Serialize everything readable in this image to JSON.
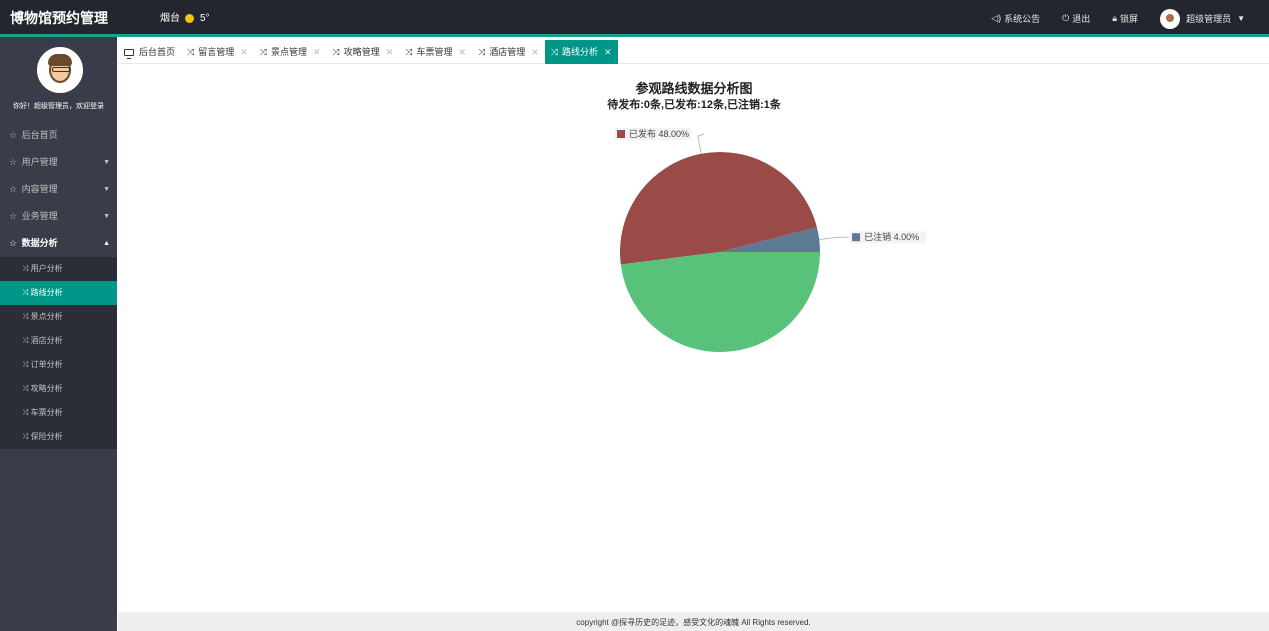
{
  "header": {
    "brand": "博物馆预约管理",
    "city": "烟台",
    "temperature": "5°",
    "notice": "系统公告",
    "logout": "退出",
    "lock": "锁屏",
    "user_name": "超级管理员"
  },
  "sidebar": {
    "welcome": "你好！超级管理员，欢迎登录",
    "menus": [
      {
        "label": "后台首页"
      },
      {
        "label": "用户管理"
      },
      {
        "label": "内容管理"
      },
      {
        "label": "业务管理"
      },
      {
        "label": "数据分析"
      }
    ],
    "sub_items": [
      {
        "label": "用户分析"
      },
      {
        "label": "路线分析"
      },
      {
        "label": "景点分析"
      },
      {
        "label": "酒店分析"
      },
      {
        "label": "订单分析"
      },
      {
        "label": "攻略分析"
      },
      {
        "label": "车票分析"
      },
      {
        "label": "保险分析"
      }
    ]
  },
  "tabs": [
    {
      "label": "后台首页"
    },
    {
      "label": "留言管理"
    },
    {
      "label": "景点管理"
    },
    {
      "label": "攻略管理"
    },
    {
      "label": "车票管理"
    },
    {
      "label": "酒店管理"
    },
    {
      "label": "路线分析"
    }
  ],
  "chart_data": {
    "type": "pie",
    "title": "参观路线数据分析图",
    "subtitle": "待发布:0条,已发布:12条,已注销:1条",
    "slices": [
      {
        "name": "已发布",
        "value": 48.0,
        "label": "已发布 48.00%",
        "color": "#9a4b48"
      },
      {
        "name": "已注销",
        "value": 4.0,
        "label": "已注销 4.00%",
        "color": "#5d7a94"
      },
      {
        "name": "",
        "value": 48.0,
        "label": "",
        "color": "#58c27a"
      }
    ]
  },
  "footer": {
    "copyright": "copyright @探寻历史的足迹，感受文化的魂魄 All Rights reserved."
  }
}
